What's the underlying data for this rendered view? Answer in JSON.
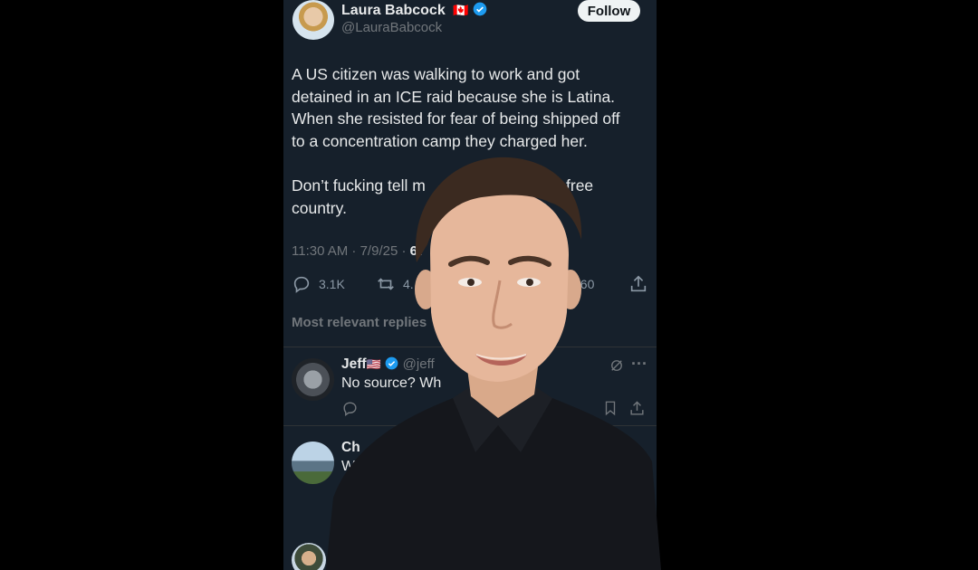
{
  "tweet": {
    "author_name": "Laura Babcock",
    "author_flag": "🇨🇦",
    "author_handle": "@LauraBabcock",
    "follow_label": "Follow",
    "line1": "A US citizen was walking to work and got",
    "line2": "detained in an ICE raid because she is Latina.",
    "line3": "When she resisted for fear of being shipped off",
    "line4": "to a concentration camp they charged her.",
    "line5_left": "Don’t fucking tell m",
    "line5_right": "free",
    "line6": "country.",
    "timestamp": "11:30 AM · 7/9/25 · ",
    "views_partial": "67",
    "replies_count": "3.1K",
    "reposts_partial": "4.",
    "likes_partial": "460"
  },
  "section_header": "Most relevant replies",
  "replies": [
    {
      "name": "Jeff",
      "flag": "🇺🇸",
      "handle_partial": "@jeff",
      "text_partial": "No source? Wh"
    },
    {
      "name_partial": "Ch",
      "text_partial": "W"
    }
  ],
  "colors": {
    "background": "#16202b",
    "text": "#e7e9ea",
    "muted": "#71767b",
    "verified": "#1d9bf0"
  },
  "icons": [
    "reply-icon",
    "repost-icon",
    "share-icon",
    "verified-badge-icon",
    "more-icon",
    "grok-icon",
    "bookmark-icon"
  ]
}
